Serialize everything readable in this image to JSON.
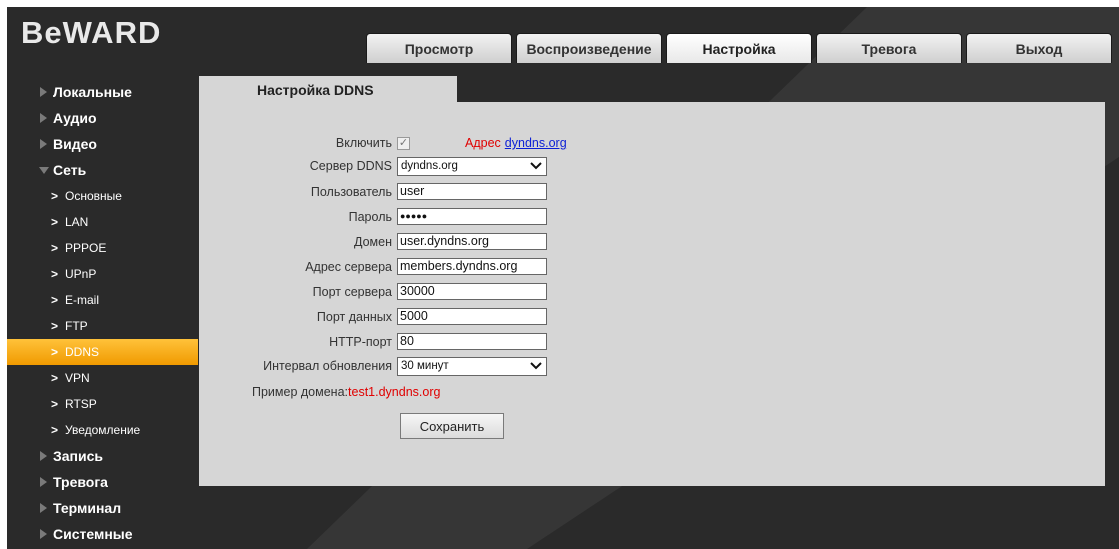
{
  "brand": {
    "logo": "BeWARD"
  },
  "tabs": [
    {
      "label": "Просмотр",
      "active": false
    },
    {
      "label": "Воспроизведение",
      "active": false
    },
    {
      "label": "Настройка",
      "active": true
    },
    {
      "label": "Тревога",
      "active": false
    },
    {
      "label": "Выход",
      "active": false
    }
  ],
  "sidebar": {
    "items": [
      {
        "label": "Локальные",
        "type": "main",
        "expanded": false
      },
      {
        "label": "Аудио",
        "type": "main",
        "expanded": false
      },
      {
        "label": "Видео",
        "type": "main",
        "expanded": false
      },
      {
        "label": "Сеть",
        "type": "main",
        "expanded": true
      },
      {
        "label": "Основные",
        "type": "sub"
      },
      {
        "label": "LAN",
        "type": "sub"
      },
      {
        "label": "PPPOE",
        "type": "sub"
      },
      {
        "label": "UPnP",
        "type": "sub"
      },
      {
        "label": "E-mail",
        "type": "sub"
      },
      {
        "label": "FTP",
        "type": "sub"
      },
      {
        "label": "DDNS",
        "type": "sub",
        "active": true
      },
      {
        "label": "VPN",
        "type": "sub"
      },
      {
        "label": "RTSP",
        "type": "sub"
      },
      {
        "label": "Уведомление",
        "type": "sub"
      },
      {
        "label": "Запись",
        "type": "main",
        "expanded": false
      },
      {
        "label": "Тревога",
        "type": "main",
        "expanded": false
      },
      {
        "label": "Терминал",
        "type": "main",
        "expanded": false
      },
      {
        "label": "Системные",
        "type": "main",
        "expanded": false
      }
    ]
  },
  "content": {
    "tab_title": "Настройка DDNS",
    "enable": {
      "label": "Включить",
      "checked": true,
      "note_prefix": "Адрес",
      "note_link": "dyndns.org"
    },
    "server": {
      "label": "Сервер DDNS",
      "value": "dyndns.org"
    },
    "user": {
      "label": "Пользователь",
      "value": "user"
    },
    "password": {
      "label": "Пароль",
      "value": "●●●●●"
    },
    "domain": {
      "label": "Домен",
      "value": "user.dyndns.org"
    },
    "server_address": {
      "label": "Адрес сервера",
      "value": "members.dyndns.org"
    },
    "server_port": {
      "label": "Порт сервера",
      "value": "30000"
    },
    "data_port": {
      "label": "Порт данных",
      "value": "5000"
    },
    "http_port": {
      "label": "HTTP-порт",
      "value": "80"
    },
    "update_interval": {
      "label": "Интервал обновления",
      "value": "30 минут"
    },
    "example": {
      "label": "Пример домена:",
      "value": "test1.dyndns.org"
    },
    "save_label": "Сохранить"
  },
  "icons": {
    "checkmark": "✓",
    "chevron_right": ">",
    "dropdown_arrow": "chevron-down"
  },
  "colors": {
    "accent": "#f5a300",
    "background": "#2a2a2a",
    "panel": "#d6d6d6",
    "note_red": "#e00000",
    "link_blue": "#0b1fd6"
  }
}
